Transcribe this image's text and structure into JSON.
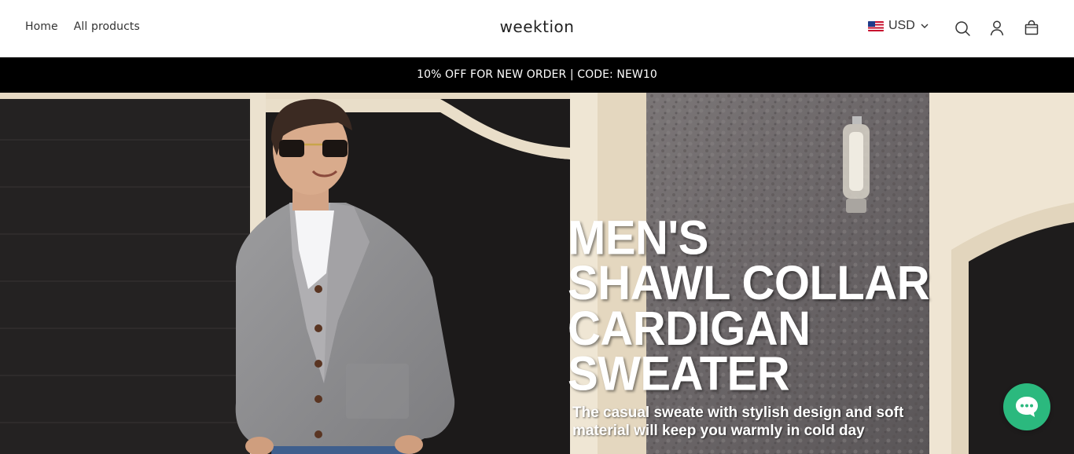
{
  "header": {
    "nav": [
      {
        "label": "Home"
      },
      {
        "label": "All products"
      }
    ],
    "logo": "weektion",
    "currency": {
      "flag": "us-flag-icon",
      "code": "USD"
    },
    "icons": [
      "search-icon",
      "account-icon",
      "cart-icon"
    ]
  },
  "announcement": {
    "text": "10% OFF FOR NEW ORDER | CODE: NEW10"
  },
  "hero": {
    "headline_lines": [
      "MEN'S",
      "SHAWL COLLAR",
      "CARDIGAN",
      "SWEATER"
    ],
    "subtext_line1": "The casual sweate with stylish design and soft",
    "subtext_line2": "material  will keep you warmly in cold day"
  },
  "chat": {
    "icon": "chat-bubble-icon",
    "color": "#2bb97e"
  },
  "colors": {
    "announcement_bg": "#000000",
    "accent": "#2bb97e"
  }
}
